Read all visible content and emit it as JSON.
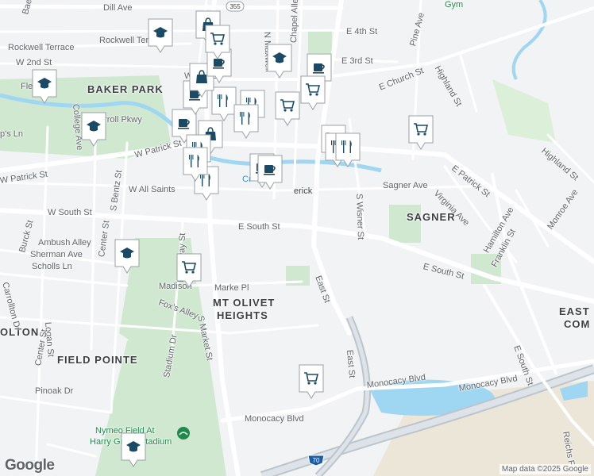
{
  "map": {
    "attribution": "Map data ©2025 Google",
    "logo": "Google",
    "route_shields": [
      "355",
      "70"
    ],
    "colors": {
      "background": "#f1f3f4",
      "road": "#ffffff",
      "park": "#cfe8cf",
      "water": "#9fd6f2",
      "highway": "#bcc5cc",
      "marker": "#1a4a66"
    }
  },
  "labels": {
    "dill_ave": "Dill Ave",
    "e_4th_st": "E 4th St",
    "rockwell_terrace": "Rockwell Terrace",
    "w_2nd_st": "W 2nd St",
    "w_3rd": "W 3rd",
    "e_3rd_st": "E 3rd St",
    "w_2nd_st2": "W 2nd St",
    "baker_park": "BAKER PARK",
    "e_church_st": "E Church St",
    "highland_st": "Highland St",
    "pine_ave": "Pine Ave",
    "chapel_alley": "Chapel Alley",
    "n_maxwell": "N Maxwell",
    "carroll_pkwy": "Carroll Pkwy",
    "w_patrick_st": "W Patrick St",
    "w_patrick_st2": "W Patrick St",
    "college_ave": "College Ave",
    "flemin": "Flemin",
    "ps_ln": "p's Ln",
    "baer_alley": "Baer Alley",
    "w_all_saints": "W All Saints",
    "erick": "erick",
    "creek": "Cr",
    "sagner_ave": "Sagner Ave",
    "virginia_ave": "Virginia Ave",
    "e_patrick_st": "E Patrick St",
    "highland_st2": "Highland St",
    "monroe_ave": "Monroe Ave",
    "sagner": "SAGNER",
    "hamilton_ave": "Hamilton Ave",
    "franklin_st": "Franklin St",
    "s_wisner_st": "S Wisner St",
    "w_south_st": "W South St",
    "e_south_st": "E South St",
    "e_south_st2": "E South St",
    "burck_st": "Burck St",
    "ambush_alley": "Ambush Alley",
    "sherman_ave": "Sherman Ave",
    "scholls_ln": "Scholls Ln",
    "center_st": "Center St",
    "s_bentz_st": "S Bentz St",
    "broadway_st": "Broadway St",
    "madison": "Madison",
    "marke_pl": "Marke Pl",
    "foxs_alley": "Fox's Alley",
    "mt_olivet_heights_1": "MT OLIVET",
    "mt_olivet_heights_2": "HEIGHTS",
    "s_market_st": "S Market St",
    "east_st": "East St",
    "east_st2": "East St",
    "east_1": "EAST",
    "east_2": "COM",
    "e_south_st3": "E South St",
    "olton": "OLTON",
    "logan_st": "Logan St",
    "center_st2": "Center St",
    "field_pointe": "FIELD POINTE",
    "stadium_dr": "Stadium Dr",
    "pinoak_dr": "Pinoak Dr",
    "carrollton_dr": "Carrollton Dr",
    "monocacy_blvd": "Monocacy Blvd",
    "monocacy_blvd2": "Monocacy Blvd",
    "monocacy_blvd3": "Monocacy Blvd",
    "nymeo_1": "Nymeo Field At",
    "nymeo_2": "Harry Grove Stadium",
    "reichs": "Reichs F",
    "gym": "Gym",
    "alley": "Alley",
    "e_south_st_sep": "E South St"
  },
  "markers": [
    {
      "type": "restaurant"
    },
    {
      "type": "school"
    },
    {
      "type": "coffee"
    },
    {
      "type": "shopping"
    },
    {
      "type": "school"
    },
    {
      "type": "school"
    },
    {
      "type": "school"
    },
    {
      "type": "coffee"
    },
    {
      "type": "restaurant"
    },
    {
      "type": "coffee"
    },
    {
      "type": "shopping"
    },
    {
      "type": "grocery"
    },
    {
      "type": "grocery"
    },
    {
      "type": "coffee"
    },
    {
      "type": "restaurant"
    },
    {
      "type": "restaurant"
    },
    {
      "type": "restaurant"
    },
    {
      "type": "grocery"
    },
    {
      "type": "shopping"
    },
    {
      "type": "coffee"
    },
    {
      "type": "grocery"
    },
    {
      "type": "restaurant"
    },
    {
      "type": "restaurant"
    },
    {
      "type": "grocery"
    },
    {
      "type": "restaurant"
    },
    {
      "type": "coffee"
    },
    {
      "type": "school"
    },
    {
      "type": "grocery"
    },
    {
      "type": "grocery"
    },
    {
      "type": "school"
    }
  ]
}
